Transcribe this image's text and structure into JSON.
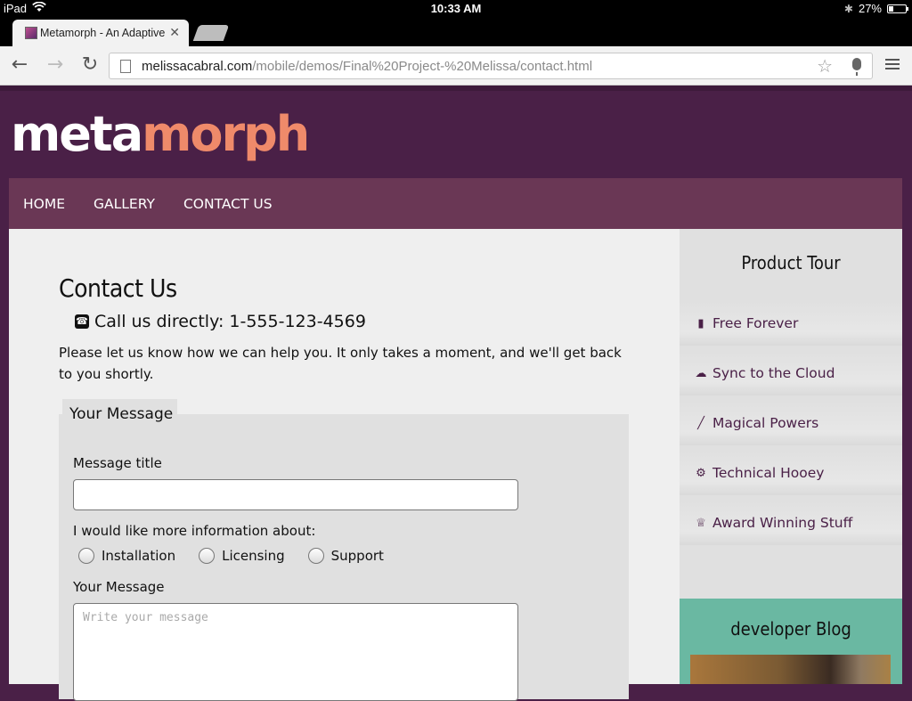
{
  "status_bar": {
    "device": "iPad",
    "time": "10:33 AM",
    "battery": "27%",
    "battery_level": 0.27
  },
  "browser": {
    "tab_title": "Metamorph - An Adaptive",
    "url_host": "melissacabral.com",
    "url_path": "/mobile/demos/Final%20Project-%20Melissa/contact.html"
  },
  "site": {
    "logo_part1": "meta",
    "logo_part2": "morph",
    "nav": [
      "HOME",
      "GALLERY",
      "CONTACT US"
    ],
    "colors": {
      "header": "#4a2047",
      "nav": "#6a3755",
      "accent": "#ef8a6a",
      "blog": "#6ab8a2"
    }
  },
  "contact": {
    "heading": "Contact Us",
    "phone": "Call us directly: 1-555-123-4569",
    "intro": "Please let us know how we can help you. It only takes a moment, and we'll get back to you shortly.",
    "legend": "Your Message",
    "title_label": "Message title",
    "title_value": "",
    "info_label": "I would like more information about:",
    "options": [
      "Installation",
      "Licensing",
      "Support"
    ],
    "message_label": "Your Message",
    "message_placeholder": "Write your message"
  },
  "sidebar": {
    "tour_title": "Product Tour",
    "items": [
      {
        "label": "Free Forever",
        "icon": "ticket-icon"
      },
      {
        "label": "Sync to the Cloud",
        "icon": "cloud-upload-icon"
      },
      {
        "label": "Magical Powers",
        "icon": "magic-wand-icon"
      },
      {
        "label": "Technical Hooey",
        "icon": "gears-icon"
      },
      {
        "label": "Award Winning Stuff",
        "icon": "trophy-icon"
      }
    ],
    "blog_title": "developer Blog"
  }
}
